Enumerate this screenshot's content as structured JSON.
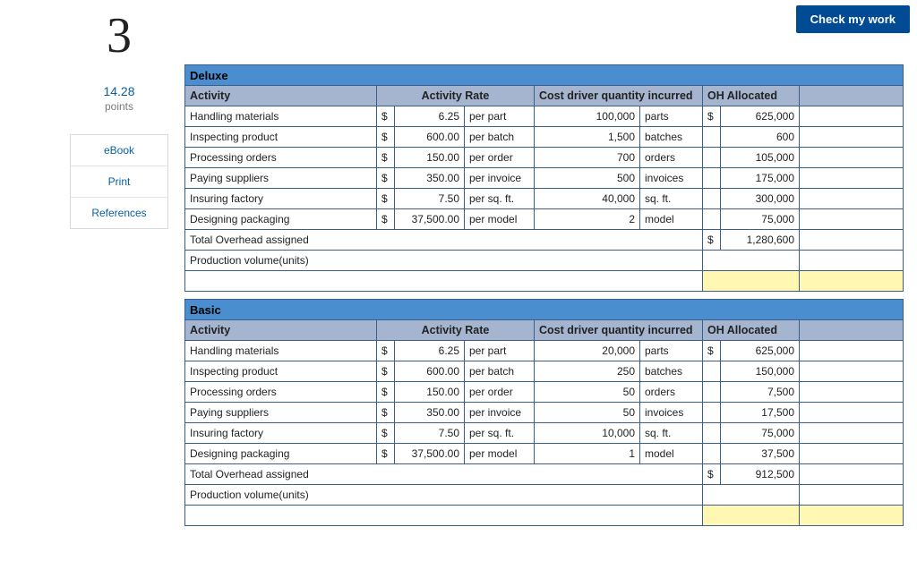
{
  "check_button": "Check my work",
  "question_number": "3",
  "points": {
    "value": "14.28",
    "label": "points"
  },
  "side_links": [
    "eBook",
    "Print",
    "References"
  ],
  "headers": {
    "activity": "Activity",
    "rate": "Activity Rate",
    "driver": "Cost driver quantity incurred",
    "allocated": "OH Allocated"
  },
  "row_labels": {
    "total_overhead": "Total Overhead assigned",
    "production_volume": "Production volume(units)"
  },
  "tables": [
    {
      "title": "Deluxe",
      "rows": [
        {
          "activity": "Handling materials",
          "cur": "$",
          "rate": "6.25",
          "rate_unit": "per part",
          "qty": "100,000",
          "qty_unit": "parts",
          "alloc_cur": "$",
          "alloc": "625,000"
        },
        {
          "activity": "Inspecting product",
          "cur": "$",
          "rate": "600.00",
          "rate_unit": "per batch",
          "qty": "1,500",
          "qty_unit": "batches",
          "alloc_cur": "",
          "alloc": "600"
        },
        {
          "activity": "Processing orders",
          "cur": "$",
          "rate": "150.00",
          "rate_unit": "per order",
          "qty": "700",
          "qty_unit": "orders",
          "alloc_cur": "",
          "alloc": "105,000"
        },
        {
          "activity": "Paying suppliers",
          "cur": "$",
          "rate": "350.00",
          "rate_unit": "per invoice",
          "qty": "500",
          "qty_unit": "invoices",
          "alloc_cur": "",
          "alloc": "175,000"
        },
        {
          "activity": "Insuring factory",
          "cur": "$",
          "rate": "7.50",
          "rate_unit": "per sq. ft.",
          "qty": "40,000",
          "qty_unit": "sq. ft.",
          "alloc_cur": "",
          "alloc": "300,000"
        },
        {
          "activity": "Designing packaging",
          "cur": "$",
          "rate": "37,500.00",
          "rate_unit": "per model",
          "qty": "2",
          "qty_unit": "model",
          "alloc_cur": "",
          "alloc": "75,000"
        }
      ],
      "total": {
        "cur": "$",
        "value": "1,280,600"
      }
    },
    {
      "title": "Basic",
      "rows": [
        {
          "activity": "Handling materials",
          "cur": "$",
          "rate": "6.25",
          "rate_unit": "per part",
          "qty": "20,000",
          "qty_unit": "parts",
          "alloc_cur": "$",
          "alloc": "625,000"
        },
        {
          "activity": "Inspecting product",
          "cur": "$",
          "rate": "600.00",
          "rate_unit": "per batch",
          "qty": "250",
          "qty_unit": "batches",
          "alloc_cur": "",
          "alloc": "150,000"
        },
        {
          "activity": "Processing orders",
          "cur": "$",
          "rate": "150.00",
          "rate_unit": "per order",
          "qty": "50",
          "qty_unit": "orders",
          "alloc_cur": "",
          "alloc": "7,500"
        },
        {
          "activity": "Paying suppliers",
          "cur": "$",
          "rate": "350.00",
          "rate_unit": "per invoice",
          "qty": "50",
          "qty_unit": "invoices",
          "alloc_cur": "",
          "alloc": "17,500"
        },
        {
          "activity": "Insuring factory",
          "cur": "$",
          "rate": "7.50",
          "rate_unit": "per sq. ft.",
          "qty": "10,000",
          "qty_unit": "sq. ft.",
          "alloc_cur": "",
          "alloc": "75,000"
        },
        {
          "activity": "Designing packaging",
          "cur": "$",
          "rate": "37,500.00",
          "rate_unit": "per model",
          "qty": "1",
          "qty_unit": "model",
          "alloc_cur": "",
          "alloc": "37,500"
        }
      ],
      "total": {
        "cur": "$",
        "value": "912,500"
      }
    }
  ]
}
